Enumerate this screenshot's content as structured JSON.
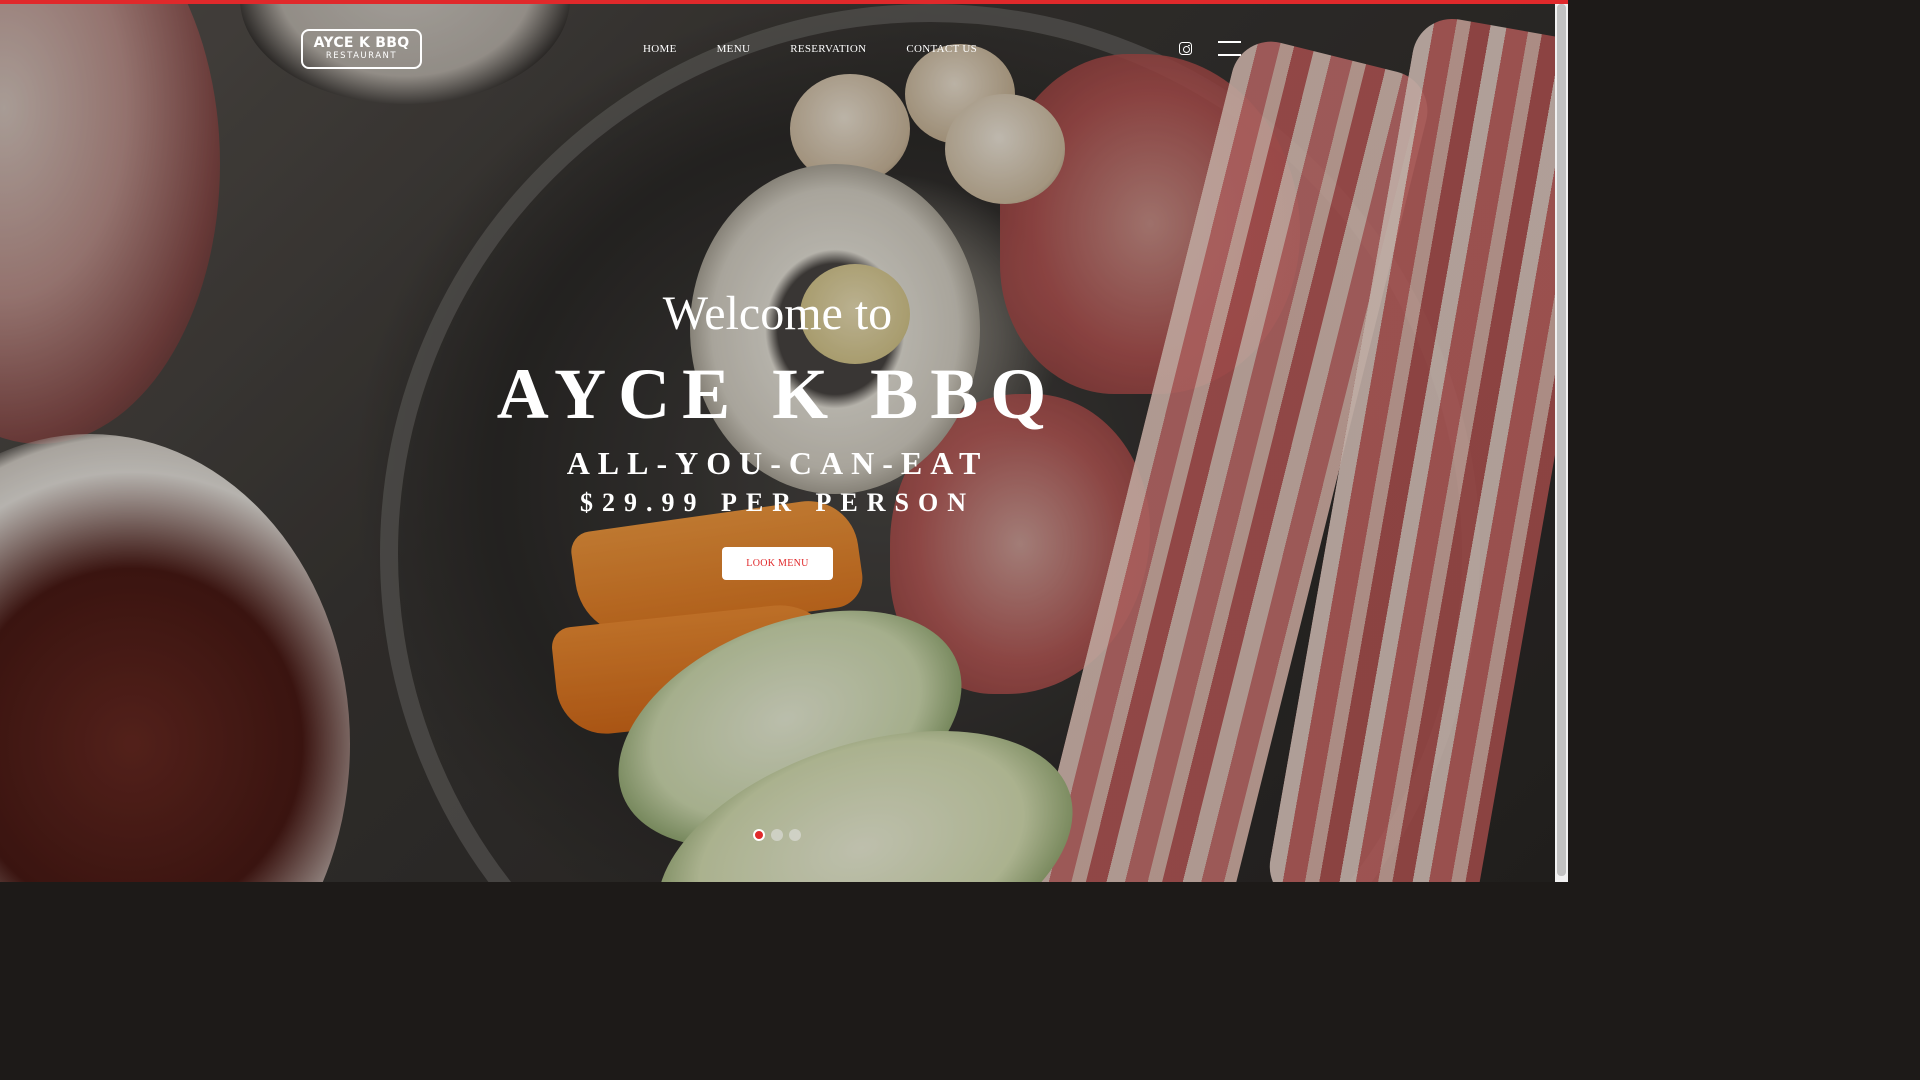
{
  "colors": {
    "accent": "#e0292b",
    "text": "#ffffff",
    "dot_inactive": "#e6e6e6"
  },
  "logo": {
    "name": "AYCE K BBQ",
    "subtitle": "RESTAURANT"
  },
  "nav": {
    "items": [
      {
        "label": "HOME"
      },
      {
        "label": "MENU"
      },
      {
        "label": "RESERVATION"
      },
      {
        "label": "CONTACT US"
      }
    ]
  },
  "icons": {
    "social": "instagram-icon",
    "menu": "hamburger-menu-icon"
  },
  "hero": {
    "welcome": "Welcome to",
    "title": "AYCE K BBQ",
    "subtitle": "ALL-YOU-CAN-EAT",
    "price": "$29.99 PER PERSON",
    "cta_label": "LOOK MENU"
  },
  "slider": {
    "total": 3,
    "active": 1
  }
}
